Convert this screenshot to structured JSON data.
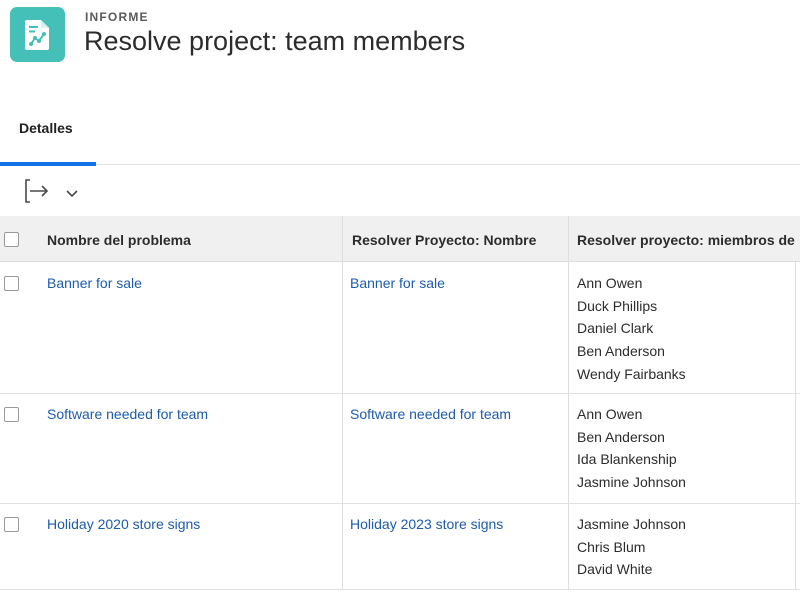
{
  "header": {
    "eyebrow": "INFORME",
    "title": "Resolve project: team members",
    "icon": "report-chart-icon",
    "icon_color": "#45c0b8"
  },
  "tabs": [
    {
      "label": "Detalles",
      "active": true
    }
  ],
  "toolbar": {
    "export_icon": "export-icon",
    "dropdown_icon": "chevron-down-icon"
  },
  "table": {
    "columns": [
      "Nombre del problema",
      "Resolver Proyecto: Nombre",
      "Resolver proyecto: miembros de"
    ],
    "rows": [
      {
        "issue": "Banner for sale",
        "project": "Banner for sale",
        "members": [
          "Ann Owen",
          "Duck Phillips",
          "Daniel Clark",
          "Ben Anderson",
          "Wendy Fairbanks"
        ]
      },
      {
        "issue": "Software needed for team",
        "project": "Software needed for team",
        "members": [
          "Ann Owen",
          "Ben Anderson",
          "Ida Blankenship",
          "Jasmine Johnson"
        ]
      },
      {
        "issue": "Holiday 2020 store signs",
        "project": "Holiday 2023 store signs",
        "members": [
          "Jasmine Johnson",
          "Chris Blum",
          "David White"
        ]
      }
    ]
  },
  "colors": {
    "link": "#1d5bac",
    "active_tab": "#1473e6",
    "header_bg": "#f0f0f0"
  }
}
